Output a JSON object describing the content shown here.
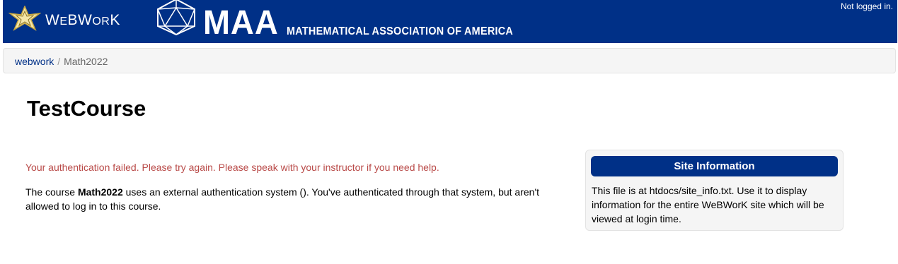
{
  "header": {
    "logo_text_first": "W",
    "logo_text_rest1": "E",
    "logo_text_mid": "BW",
    "logo_text_rest2": "OR",
    "logo_text_last": "K",
    "maa_big": "MAA",
    "maa_full": "MATHEMATICAL ASSOCIATION OF AMERICA",
    "login_status": "Not logged in.",
    "colors": {
      "masthead": "#003087"
    },
    "icons": {
      "logo": "star-logo-icon",
      "maa": "icosahedron-logo-icon"
    }
  },
  "breadcrumb": {
    "root": "webwork",
    "separator": "/",
    "current": "Math2022"
  },
  "main": {
    "title": "TestCourse",
    "error": "Your authentication failed. Please try again. Please speak with your instructor if you need help.",
    "info_pre": "The course ",
    "info_course": "Math2022",
    "info_post": " uses an external authentication system (). You've authenticated through that system, but aren't allowed to log in to this course.",
    "colors": {
      "error": "#b94a48"
    }
  },
  "site_info": {
    "heading": "Site Information",
    "body": "This file is at htdocs/site_info.txt. Use it to display information for the entire WeBWorK site which will be viewed at login time."
  }
}
